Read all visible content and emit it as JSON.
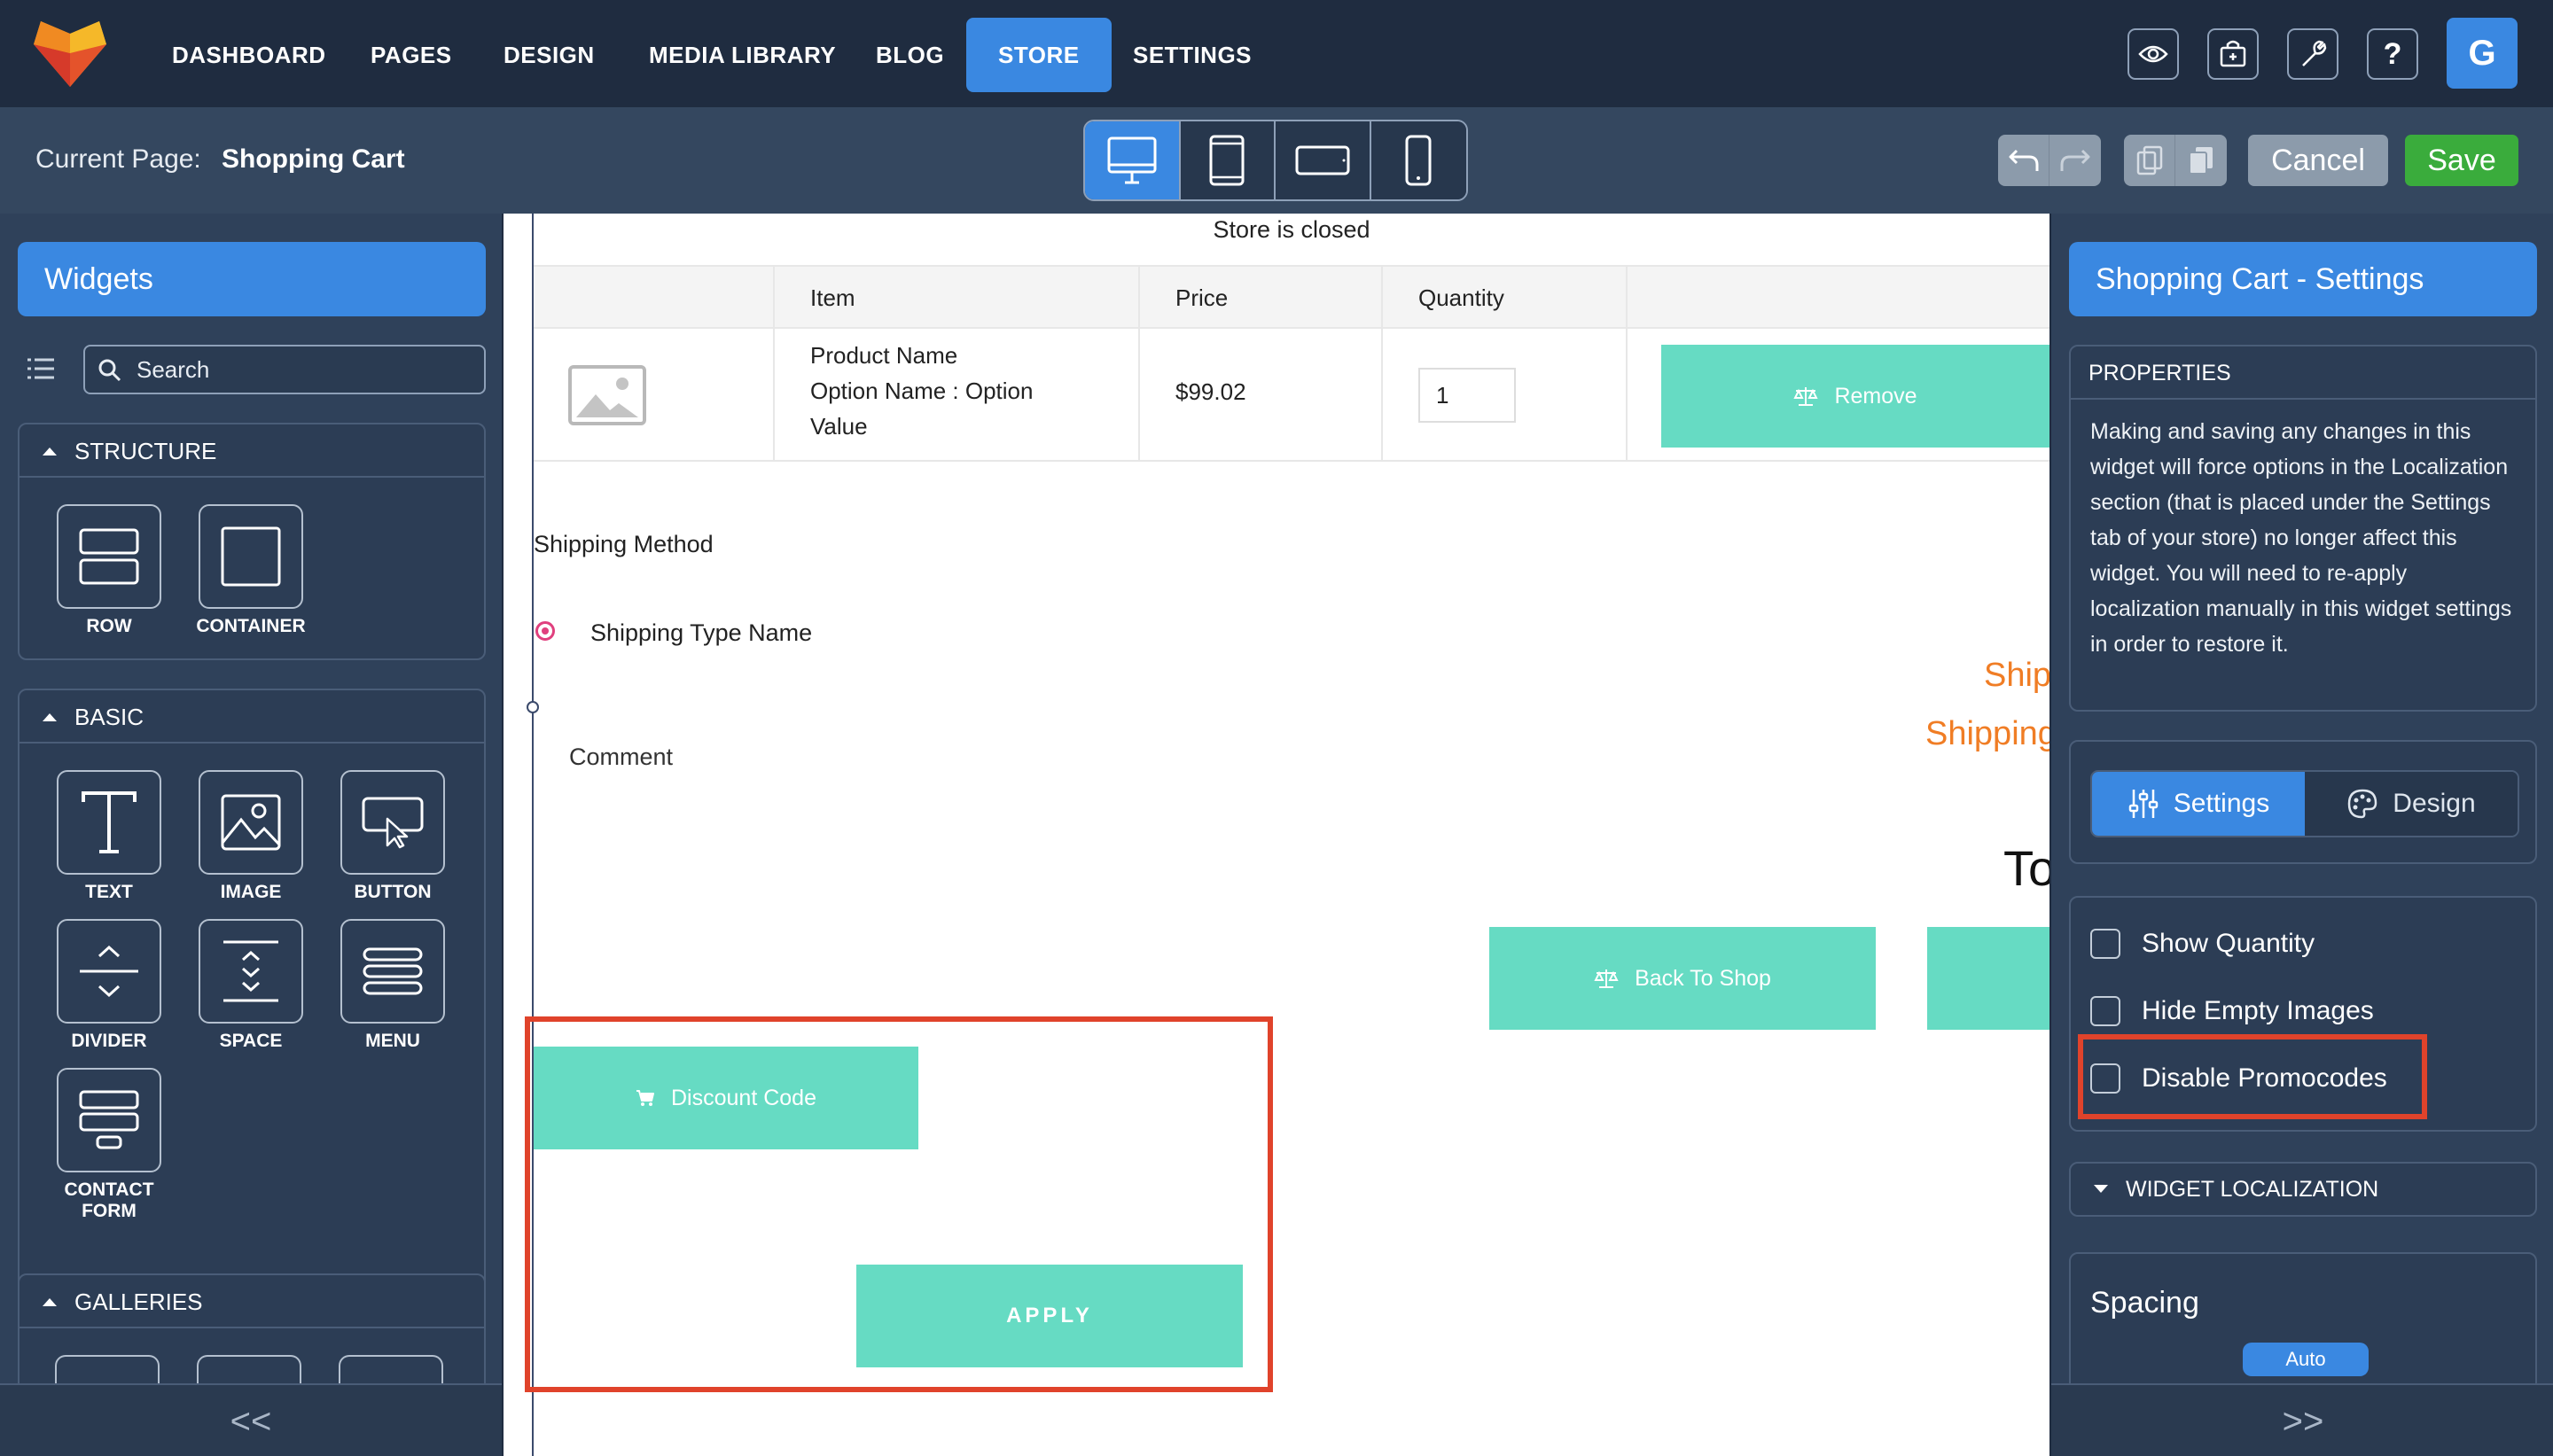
{
  "topnav": {
    "items": [
      "DASHBOARD",
      "PAGES",
      "DESIGN",
      "MEDIA LIBRARY",
      "BLOG",
      "STORE",
      "SETTINGS"
    ],
    "active": "STORE",
    "icons": [
      "eye-icon",
      "store-icon",
      "wrench-icon",
      "help-icon"
    ],
    "help_label": "?",
    "avatar_letter": "G"
  },
  "subbar": {
    "current_page_label": "Current Page:",
    "current_page_value": "Shopping Cart",
    "devices": [
      "desktop",
      "tablet-portrait",
      "tablet-landscape",
      "phone"
    ],
    "active_device": "desktop",
    "cancel_label": "Cancel",
    "save_label": "Save"
  },
  "left_panel": {
    "title": "Widgets",
    "search_placeholder": "Search",
    "sections": {
      "structure": {
        "title": "STRUCTURE",
        "items": [
          "ROW",
          "CONTAINER"
        ]
      },
      "basic": {
        "title": "BASIC",
        "items": [
          "TEXT",
          "IMAGE",
          "BUTTON",
          "DIVIDER",
          "SPACE",
          "MENU",
          "CONTACT FORM"
        ]
      },
      "galleries": {
        "title": "GALLERIES"
      }
    },
    "collapse_label": "<<"
  },
  "canvas": {
    "store_closed": "Store is closed",
    "table": {
      "headers": [
        "Item",
        "Price",
        "Quantity"
      ],
      "row": {
        "product_name": "Product Name",
        "option_line": "Option Name : Option",
        "option_line2": "Value",
        "price": "$99.02",
        "quantity": "1",
        "remove_label": "Remove"
      }
    },
    "shipping_method": "Shipping Method",
    "shipping_type": "Shipping Type Name",
    "comment_label": "Comment",
    "ship_text_1": "Ship",
    "ship_text_2": "Shipping",
    "total_text": "To",
    "back_to_shop_label": "Back To Shop",
    "discount_label": "Discount Code",
    "apply_label": "APPLY",
    "accent_color": "#66dbc3",
    "highlight_color": "#e0432b"
  },
  "right_panel": {
    "title": "Shopping Cart - Settings",
    "properties_title": "PROPERTIES",
    "properties_text": "Making and saving any changes in this widget will force options in the Localization section (that is placed under the Settings tab of your store) no longer affect this widget. You will need to re-apply localization manually in this widget settings in order to restore it.",
    "tabs": [
      "Settings",
      "Design"
    ],
    "active_tab": "Settings",
    "checkboxes": [
      "Show Quantity",
      "Hide Empty Images",
      "Disable Promocodes"
    ],
    "localization_title": "WIDGET LOCALIZATION",
    "spacing_label": "Spacing",
    "spacing_value": "Auto",
    "collapse_label": ">>"
  }
}
